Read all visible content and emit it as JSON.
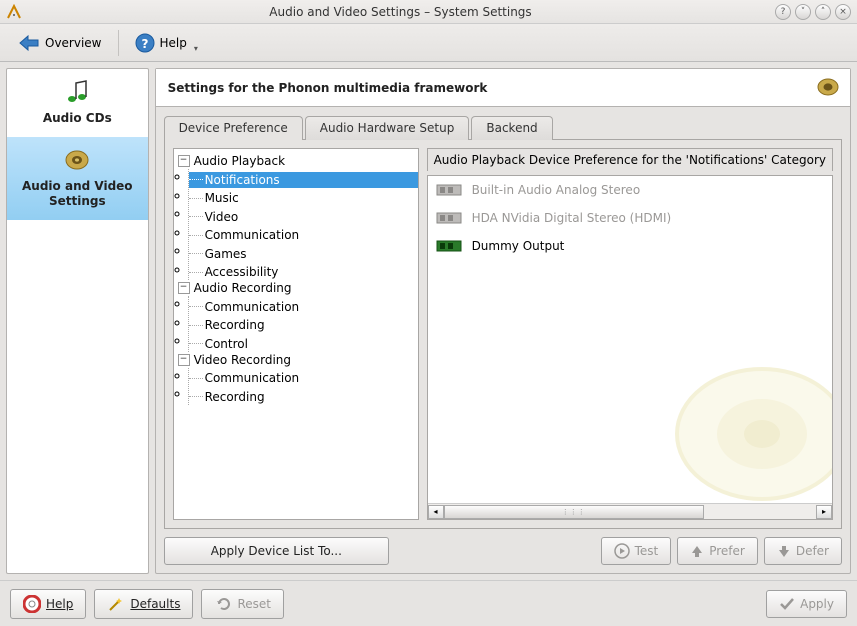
{
  "window": {
    "title": "Audio and Video Settings – System Settings"
  },
  "toolbar": {
    "overview": "Overview",
    "help": "Help"
  },
  "sidebar": {
    "items": [
      {
        "label": "Audio CDs"
      },
      {
        "label": "Audio and Video Settings"
      }
    ]
  },
  "header": {
    "title": "Settings for the Phonon multimedia framework"
  },
  "tabs": {
    "items": [
      {
        "label": "Device Preference"
      },
      {
        "label": "Audio Hardware Setup"
      },
      {
        "label": "Backend"
      }
    ]
  },
  "tree": {
    "groups": [
      {
        "label": "Audio Playback",
        "children": [
          "Notifications",
          "Music",
          "Video",
          "Communication",
          "Games",
          "Accessibility"
        ]
      },
      {
        "label": "Audio Recording",
        "children": [
          "Communication",
          "Recording",
          "Control"
        ]
      },
      {
        "label": "Video Recording",
        "children": [
          "Communication",
          "Recording"
        ]
      }
    ],
    "selected": "Notifications"
  },
  "devicelist": {
    "title": "Audio Playback Device Preference for the 'Notifications' Category",
    "devices": [
      {
        "name": "Built-in Audio Analog Stereo",
        "enabled": false
      },
      {
        "name": "HDA NVidia Digital Stereo (HDMI)",
        "enabled": false
      },
      {
        "name": "Dummy Output",
        "enabled": true
      }
    ]
  },
  "actions": {
    "apply_list": "Apply Device List To...",
    "test": "Test",
    "prefer": "Prefer",
    "defer": "Defer"
  },
  "bottom": {
    "help": "Help",
    "defaults": "Defaults",
    "reset": "Reset",
    "apply": "Apply"
  }
}
